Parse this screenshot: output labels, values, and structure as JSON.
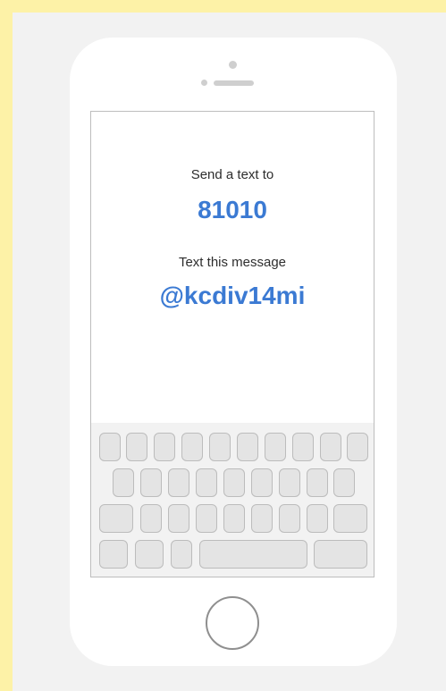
{
  "screen": {
    "send_label": "Send a text to",
    "number": "81010",
    "message_label": "Text this message",
    "message_code": "@kcdiv14mi"
  },
  "colors": {
    "accent": "#3b7ad3",
    "page_border": "#fdf2a7",
    "background": "#f2f2f2"
  },
  "icons": {
    "home": "home-button-icon",
    "camera": "camera-dot-icon",
    "speaker": "speaker-bar-icon"
  }
}
